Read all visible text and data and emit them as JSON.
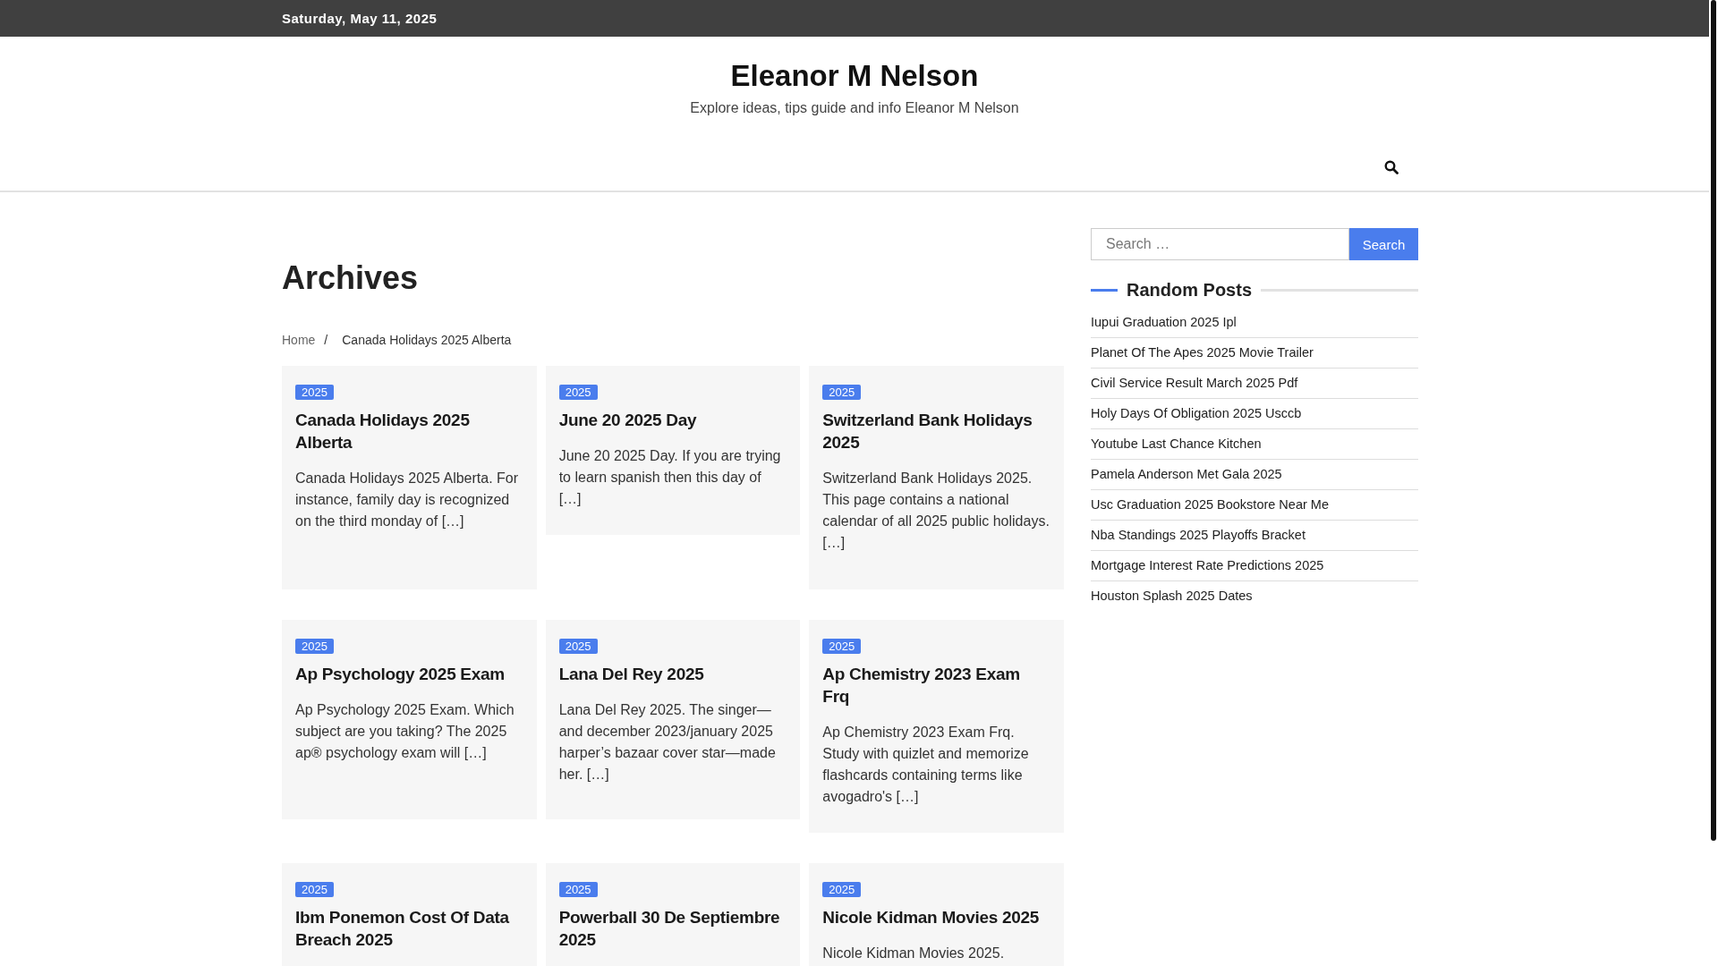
{
  "top_bar": {
    "date": "Saturday, May 11, 2025"
  },
  "header": {
    "site_title": "Eleanor M Nelson",
    "tagline": "Explore ideas, tips guide and info Eleanor M Nelson"
  },
  "page_title": "Archives",
  "breadcrumb": {
    "separator": "/",
    "items": [
      "Home",
      "Canada Holidays 2025 Alberta"
    ]
  },
  "posts": [
    {
      "category": "2025",
      "title": "Canada Holidays 2025 Alberta",
      "excerpt": "Canada Holidays 2025 Alberta. For instance, family day is recognized on the third monday of […]"
    },
    {
      "category": "2025",
      "title": "June 20 2025 Day",
      "excerpt": "June 20 2025 Day. If you are trying to learn spanish then this day of […]"
    },
    {
      "category": "2025",
      "title": "Switzerland Bank Holidays 2025",
      "excerpt": "Switzerland Bank Holidays 2025. This page contains a national calendar of all 2025 public holidays. […]"
    },
    {
      "category": "2025",
      "title": "Ap Psychology 2025 Exam",
      "excerpt": "Ap Psychology 2025 Exam. Which subject are you taking? The 2025 ap® psychology exam will […]"
    },
    {
      "category": "2025",
      "title": "Lana Del Rey 2025",
      "excerpt": "Lana Del Rey 2025. The singer—and december 2023/january 2025 harper’s bazaar cover star—made her. […]"
    },
    {
      "category": "2025",
      "title": "Ap Chemistry 2023 Exam Frq",
      "excerpt": "Ap Chemistry 2023 Exam Frq. Study with quizlet and memorize flashcards containing terms like avogadro's […]"
    },
    {
      "category": "2025",
      "title": "Ibm Ponemon Cost Of Data Breach 2025"
    },
    {
      "category": "2025",
      "title": "Powerball 30 De Septiembre 2025"
    },
    {
      "category": "2025",
      "title": "Nicole Kidman Movies 2025",
      "excerpt": "Nicole Kidman Movies 2025."
    }
  ],
  "sidebar": {
    "search": {
      "placeholder": "Search …",
      "button": "Search"
    },
    "widget_title": "Random Posts",
    "random_posts": [
      "Iupui Graduation 2025 Ipl",
      "Planet Of The Apes 2025 Movie Trailer",
      "Civil Service Result March 2025 Pdf",
      "Holy Days Of Obligation 2025 Usccb",
      "Youtube Last Chance Kitchen",
      "Pamela Anderson Met Gala 2025",
      "Usc Graduation 2025 Bookstore Near Me",
      "Nba Standings 2025 Playoffs Bracket",
      "Mortgage Interest Rate Predictions 2025",
      "Houston Splash 2025 Dates"
    ]
  }
}
